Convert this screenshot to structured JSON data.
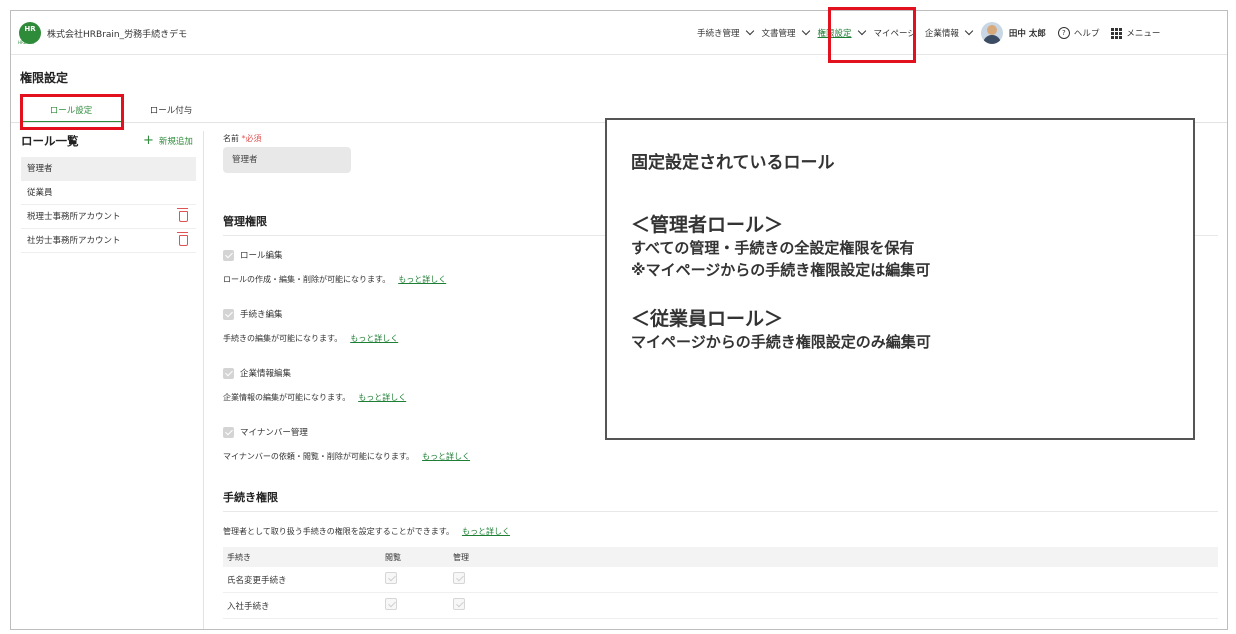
{
  "header": {
    "logo_text": "HR",
    "logo_sub": "HRBrain",
    "company": "株式会社HRBrain_労務手続きデモ",
    "nav": [
      {
        "label": "手続き管理"
      },
      {
        "label": "文書管理"
      },
      {
        "label": "権限設定"
      },
      {
        "label": "マイページ"
      },
      {
        "label": "企業情報"
      }
    ],
    "user_name": "田中 太郎",
    "help_label": "ヘルプ",
    "help_glyph": "?",
    "menu_label": "メニュー"
  },
  "page": {
    "title": "権限設定",
    "tabs": [
      "ロール設定",
      "ロール付与"
    ]
  },
  "roles": {
    "heading": "ロール一覧",
    "add_label": "新規追加",
    "add_glyph": "+",
    "items": [
      {
        "label": "管理者"
      },
      {
        "label": "従業員"
      },
      {
        "label": "税理士事務所アカウント"
      },
      {
        "label": "社労士事務所アカウント"
      }
    ]
  },
  "form": {
    "name_label": "名前",
    "required_label": "*必須",
    "name_value": "管理者",
    "admin_section_title": "管理権限",
    "permissions": [
      {
        "label": "ロール編集",
        "desc": "ロールの作成・編集・削除が可能になります。",
        "link": "もっと詳しく"
      },
      {
        "label": "手続き編集",
        "desc": "手続きの編集が可能になります。",
        "link": "もっと詳しく"
      },
      {
        "label": "企業情報編集",
        "desc": "企業情報の編集が可能になります。",
        "link": "もっと詳しく"
      },
      {
        "label": "マイナンバー管理",
        "desc": "マイナンバーの依頼・閲覧・削除が可能になります。",
        "link": "もっと詳しく"
      }
    ],
    "proc_section_title": "手続き権限",
    "proc_desc": "管理者として取り扱う手続きの権限を設定することができます。",
    "proc_link": "もっと詳しく",
    "table": {
      "columns": [
        "手続き",
        "閲覧",
        "管理"
      ],
      "rows": [
        {
          "name": "氏名変更手続き"
        },
        {
          "name": "入社手続き"
        }
      ]
    }
  },
  "annotation": {
    "title": "固定設定されているロール",
    "admin_heading": "＜管理者ロール＞",
    "admin_line1": "すべての管理・手続きの全設定権限を保有",
    "admin_line2": "※マイページからの手続き権限設定は編集可",
    "employee_heading": "＜従業員ロール＞",
    "employee_line1": "マイページからの手続き権限設定のみ編集可"
  },
  "colors": {
    "accent": "#2e8b3a",
    "highlight": "#e3101d",
    "danger": "#e05353"
  }
}
